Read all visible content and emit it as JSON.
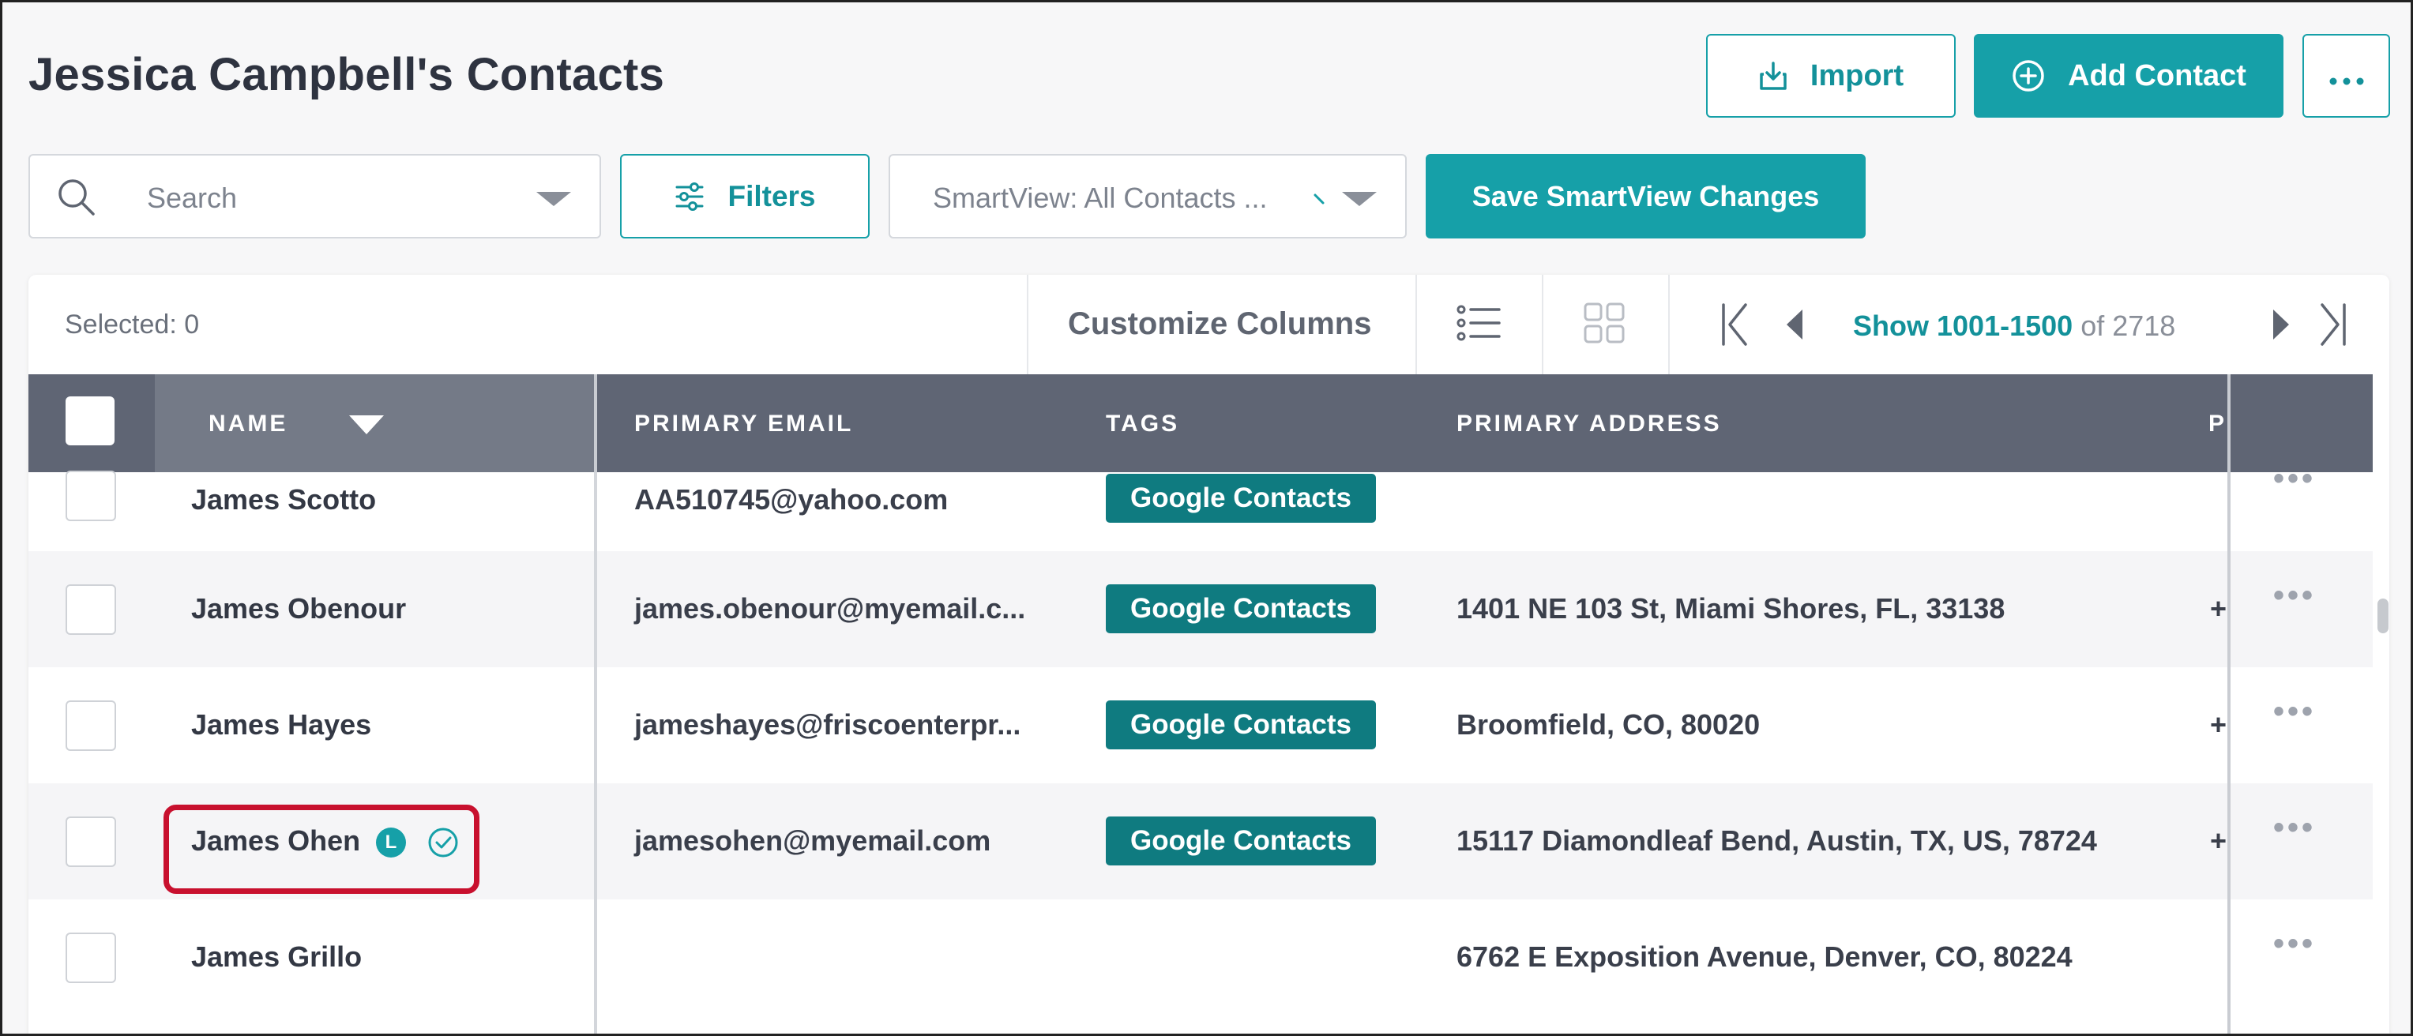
{
  "page": {
    "title": "Jessica Campbell's Contacts"
  },
  "header_actions": {
    "import_label": "Import",
    "add_contact_label": "Add Contact"
  },
  "filters_bar": {
    "search_placeholder": "Search",
    "filters_label": "Filters",
    "smartview_value": "SmartView: All Contacts ...",
    "save_smartview_label": "Save SmartView Changes"
  },
  "toolbar": {
    "selected_text": "Selected: 0",
    "customize_columns_label": "Customize Columns",
    "pagination": {
      "show_prefix": "Show",
      "range": "1001-1500",
      "of_text": "of 2718"
    }
  },
  "table": {
    "columns": [
      "NAME",
      "PRIMARY EMAIL",
      "TAGS",
      "PRIMARY ADDRESS",
      "P"
    ],
    "rows": [
      {
        "name": "James Scotto",
        "email": "AA510745@yahoo.com",
        "tag": "Google Contacts",
        "address": "",
        "phone": ""
      },
      {
        "name": "James Obenour",
        "email": "james.obenour@myemail.c...",
        "tag": "Google Contacts",
        "address": "1401 NE 103 St, Miami Shores, FL, 33138",
        "phone": "+"
      },
      {
        "name": "James Hayes",
        "email": "jameshayes@friscoenterpr...",
        "tag": "Google Contacts",
        "address": "Broomfield, CO, 80020",
        "phone": "+"
      },
      {
        "name": "James Ohen",
        "email": "jamesohen@myemail.com",
        "tag": "Google Contacts",
        "address": "15117 Diamondleaf Bend, Austin, TX, US, 78724",
        "phone": "+",
        "badge": "L"
      },
      {
        "name": "James Grillo",
        "email": "",
        "tag": "",
        "address": "6762 E Exposition Avenue, Denver, CO, 80224",
        "phone": ""
      }
    ]
  },
  "colors": {
    "accent": "#16a0a8",
    "tag_bg": "#0f7b80",
    "header_bg": "#5f6574",
    "highlight": "#c8102e"
  }
}
